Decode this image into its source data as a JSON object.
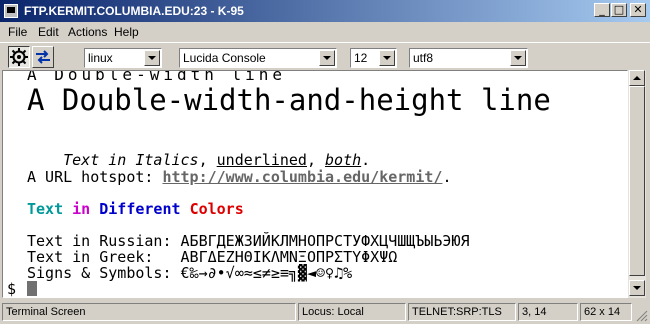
{
  "window": {
    "title": "FTP.KERMIT.COLUMBIA.EDU:23 - K-95"
  },
  "window_buttons": {
    "minimize": "_",
    "maximize": "□",
    "close": "✕"
  },
  "menu": [
    "File",
    "Edit",
    "Actions",
    "Help"
  ],
  "toolbar": {
    "terminal_type": "linux",
    "font": "Lucida Console",
    "font_size": "12",
    "charset": "utf8"
  },
  "terminal": {
    "double_width": "A Double-width line",
    "double_width_height": "A Double-width-and-height line",
    "italics": {
      "t1": "Text in Italics",
      "t2": ", ",
      "t3": "underlined",
      "t4": ", ",
      "t5": "both",
      "t6": "."
    },
    "url": {
      "prefix": "A URL hotspot: ",
      "link": "http://www.columbia.edu/kermit/",
      "suffix": "."
    },
    "colors": {
      "w1": "Text",
      "w2": "in",
      "w3": "Different",
      "w4": "Colors",
      "c1": "#009999",
      "c2": "#cc00cc",
      "c3": "#0000cc",
      "c4": "#dd0000"
    },
    "russian": "Text in Russian: АБВГДЕЖЗИЙКЛМНОПРСТУФХЦЧШЩЪЫЬЭЮЯ",
    "greek": "Text in Greek:   ΑΒΓΔΕΖΗΘΙΚΛΜΝΞΟΠΡΣΤΥΦΧΨΩ",
    "symbols": "Signs & Symbols: €‰→∂•√∞≈≤≠≥≡╗▓◄☺♀♫%",
    "prompt": "$"
  },
  "statusbar": {
    "mode": "Terminal Screen",
    "locus": "Locus: Local",
    "connection": "TELNET:SRP:TLS",
    "cursor_pos": "3, 14",
    "screen_size": "62 x 14"
  }
}
